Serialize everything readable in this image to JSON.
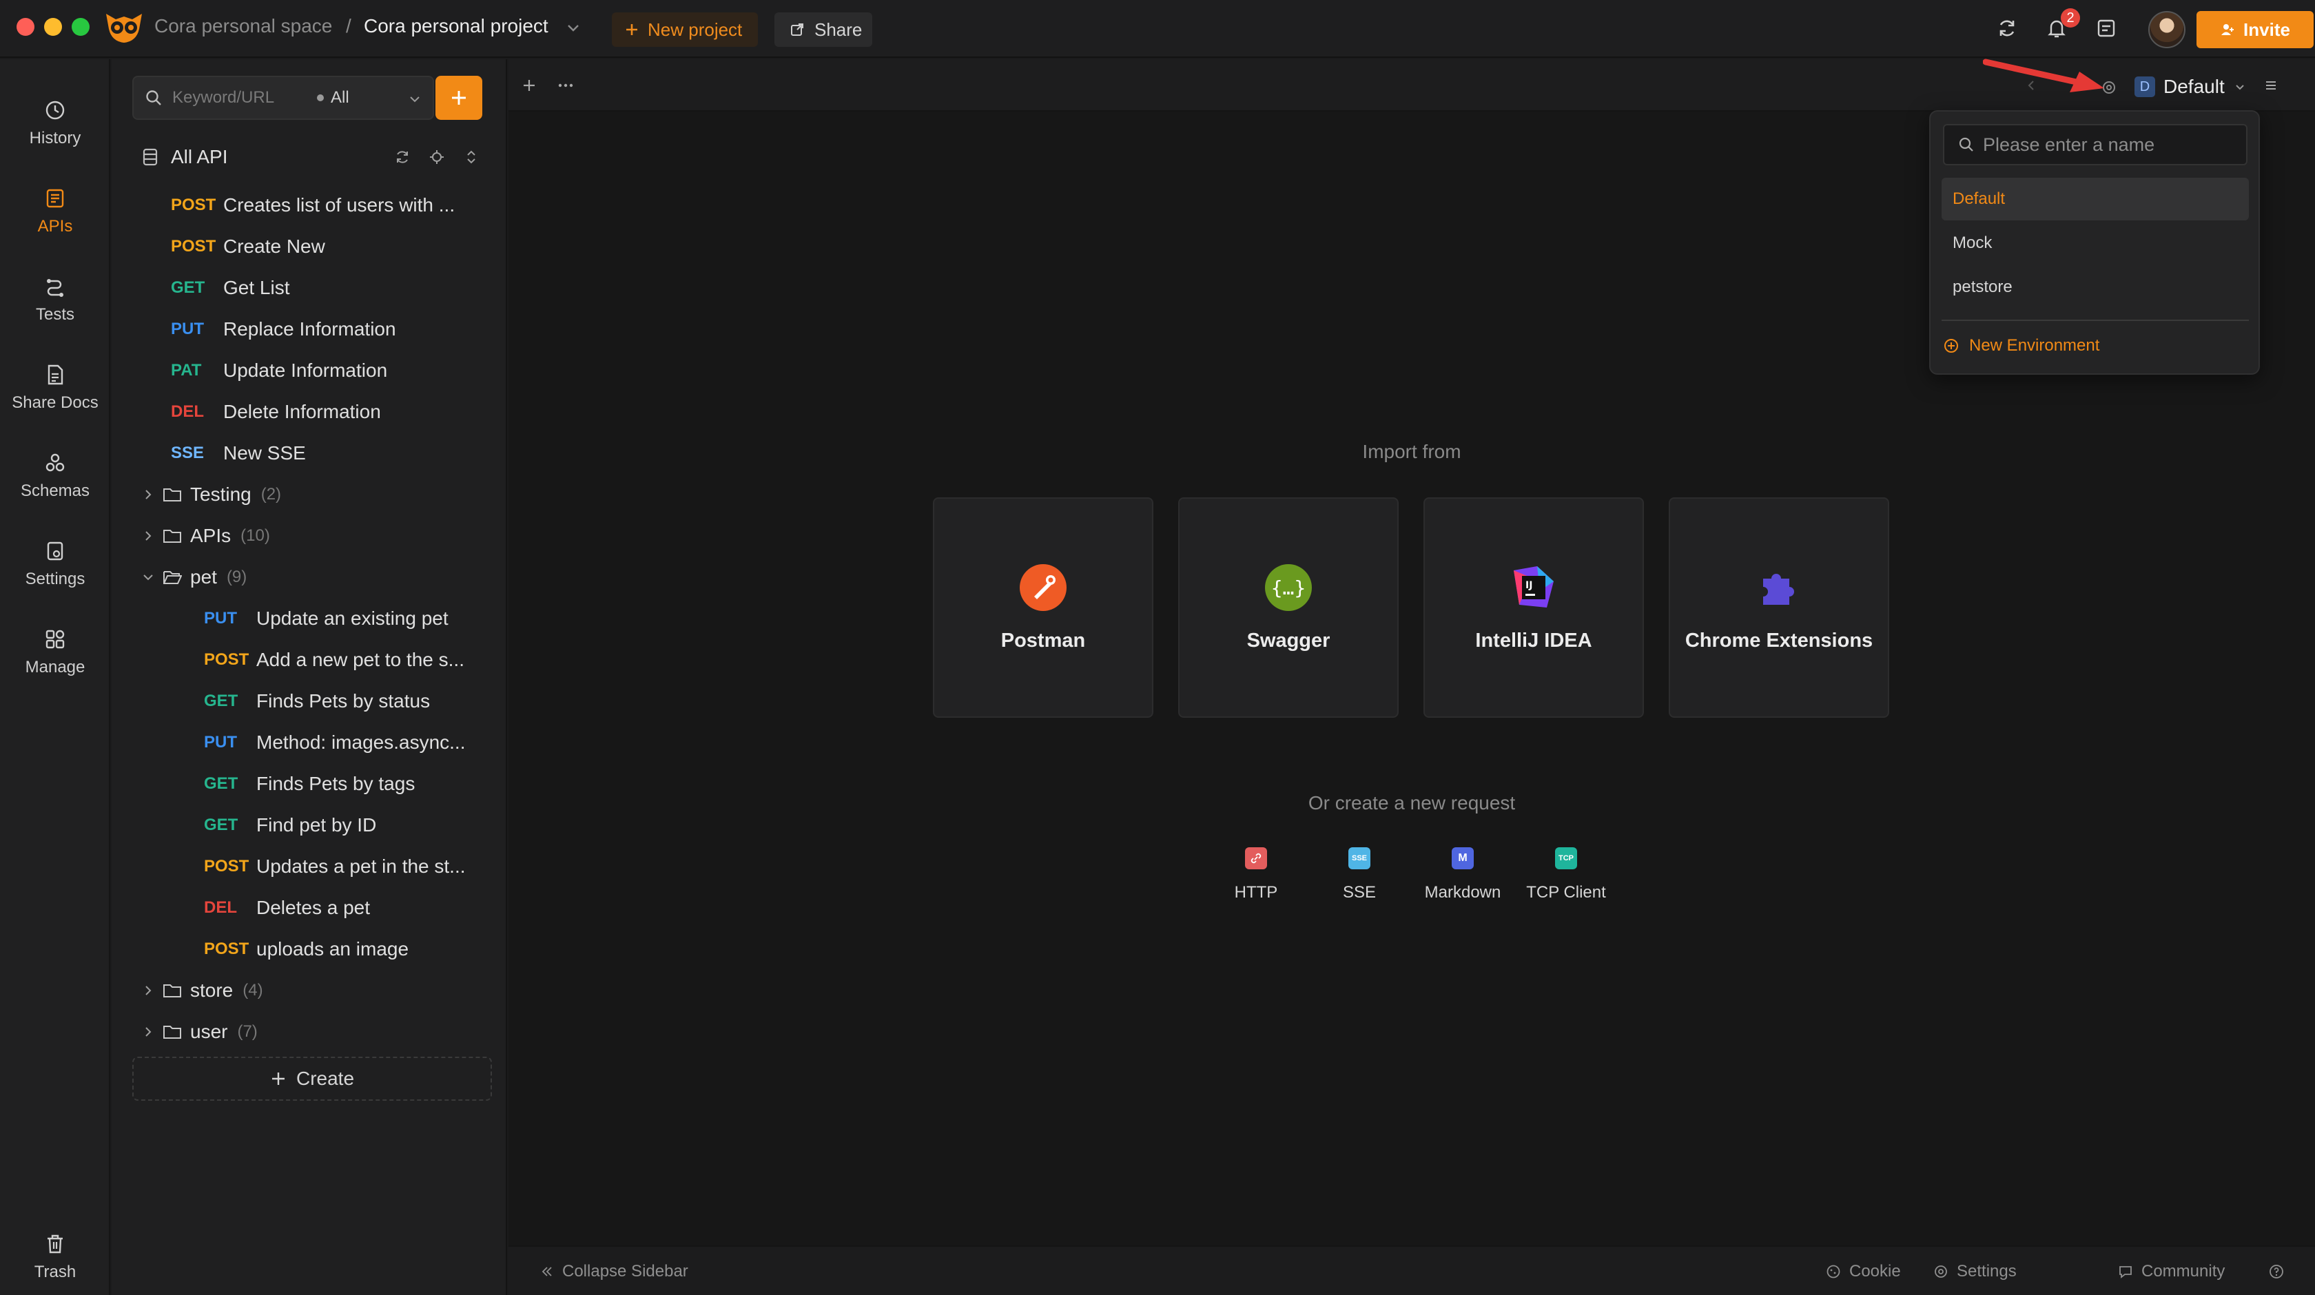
{
  "titlebar": {
    "space": "Cora personal space",
    "separator": "/",
    "project": "Cora personal project",
    "new_project": "New project",
    "share": "Share",
    "notification_count": "2",
    "invite": "Invite"
  },
  "nav": {
    "history": "History",
    "apis": "APIs",
    "tests": "Tests",
    "share_docs": "Share Docs",
    "schemas": "Schemas",
    "settings": "Settings",
    "manage": "Manage",
    "trash": "Trash"
  },
  "api_panel": {
    "search_placeholder": "Keyword/URL",
    "scope": "All",
    "all_api": "All API",
    "items": [
      {
        "method": "POST",
        "name": "Creates list of users with ..."
      },
      {
        "method": "POST",
        "name": "Create New"
      },
      {
        "method": "GET",
        "name": "Get List"
      },
      {
        "method": "PUT",
        "name": "Replace Information"
      },
      {
        "method": "PAT",
        "name": "Update Information"
      },
      {
        "method": "DEL",
        "name": "Delete Information"
      },
      {
        "method": "SSE",
        "name": "New SSE"
      }
    ],
    "folders": {
      "testing": {
        "name": "Testing",
        "count": "(2)"
      },
      "apis": {
        "name": "APIs",
        "count": "(10)"
      },
      "pet": {
        "name": "pet",
        "count": "(9)"
      },
      "store": {
        "name": "store",
        "count": "(4)"
      },
      "user": {
        "name": "user",
        "count": "(7)"
      }
    },
    "pet_items": [
      {
        "method": "PUT",
        "name": "Update an existing pet"
      },
      {
        "method": "POST",
        "name": "Add a new pet to the s..."
      },
      {
        "method": "GET",
        "name": "Finds Pets by status"
      },
      {
        "method": "PUT",
        "name": "Method: images.async..."
      },
      {
        "method": "GET",
        "name": "Finds Pets by tags"
      },
      {
        "method": "GET",
        "name": "Find pet by ID"
      },
      {
        "method": "POST",
        "name": "Updates a pet in the st..."
      },
      {
        "method": "DEL",
        "name": "Deletes a pet"
      },
      {
        "method": "POST",
        "name": "uploads an image"
      }
    ],
    "create": "Create"
  },
  "main": {
    "env_badge": "D",
    "env_name": "Default",
    "import_title": "Import from",
    "import_cards": [
      "Postman",
      "Swagger",
      "IntelliJ IDEA",
      "Chrome Extensions"
    ],
    "create_title": "Or create a new request",
    "requests": [
      "HTTP",
      "SSE",
      "Markdown",
      "TCP Client"
    ],
    "request_icon_text": [
      "",
      "SSE",
      "M",
      "TCP"
    ]
  },
  "statusbar": {
    "collapse": "Collapse Sidebar",
    "cookie": "Cookie",
    "settings": "Settings",
    "community": "Community"
  },
  "env_dropdown": {
    "placeholder": "Please enter a name",
    "options": [
      "Default",
      "Mock",
      "petstore"
    ],
    "new_env": "New Environment"
  },
  "colors": {
    "accent": "#f28a16",
    "post": "#f2a51a",
    "get": "#26b58e",
    "put": "#3a8ff0",
    "del": "#e5453c"
  }
}
